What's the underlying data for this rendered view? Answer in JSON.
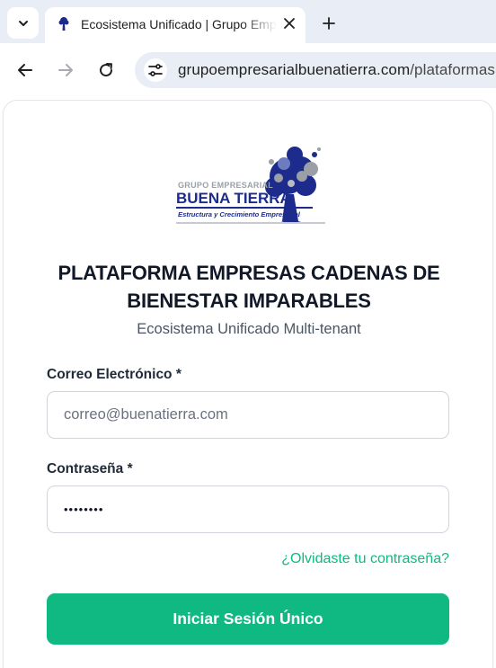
{
  "browser": {
    "tab": {
      "title": "Ecosistema Unificado | Grupo Empresarial Buena Tierra"
    },
    "address_bar": {
      "domain": "grupoempresarialbuenatierra.com",
      "path": "/plataformas"
    }
  },
  "logo": {
    "line1": "GRUPO EMPRESARIAL",
    "line2": "BUENA TIERRA",
    "line3": "Estructura y Crecimiento Empresarial"
  },
  "login": {
    "title": "PLATAFORMA EMPRESAS CADENAS DE BIENESTAR IMPARABLES",
    "subtitle": "Ecosistema Unificado Multi-tenant",
    "email_label": "Correo Electrónico",
    "email_placeholder": "correo@buenatierra.com",
    "password_label": "Contraseña",
    "password_value": "••••••••",
    "required_mark": "*",
    "forgot_link": "¿Olvidaste tu contraseña?",
    "submit_label": "Iniciar Sesión Único"
  },
  "colors": {
    "accent": "#10b981",
    "logo_blue": "#1c2b8c",
    "logo_grey": "#9aa0a6",
    "title": "#111827"
  },
  "icons": [
    "tab-search-icon",
    "favicon-tree-icon",
    "close-icon",
    "plus-icon",
    "back-arrow-icon",
    "forward-arrow-icon",
    "reload-icon",
    "site-settings-icon",
    "tree-logo-icon"
  ]
}
